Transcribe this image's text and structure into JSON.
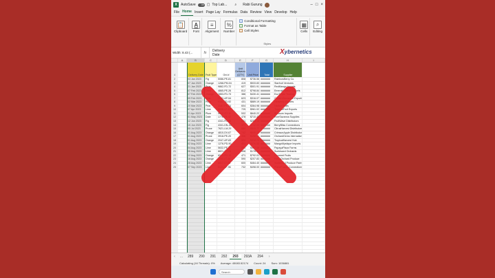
{
  "titlebar": {
    "autosave": "AutoSave",
    "toggle": "Off",
    "filename": "Top Lab...",
    "user": "Rabi Gurung"
  },
  "ribbon_tabs": [
    "File",
    "Home",
    "Insert",
    "Page Lay",
    "Formulas",
    "Data",
    "Review",
    "View",
    "Develop",
    "Help"
  ],
  "ribbon": {
    "clipboard": "Clipboard",
    "font": "Font",
    "alignment": "Alignment",
    "number": "Number",
    "cond_format": "Conditional Formatting",
    "format_table": "Format as Table",
    "cell_styles": "Cell Styles",
    "styles": "Styles",
    "cells": "Cells",
    "editing": "Editing"
  },
  "watermark": {
    "x": "X",
    "text": "ybernetics"
  },
  "formula_bar": {
    "namebox": "Width: 8.43 (...",
    "fx": "fx",
    "value_line1": "Delivery",
    "value_line2": "Date"
  },
  "columns": [
    "A",
    "B",
    "C",
    "D",
    "E",
    "F",
    "G",
    "H",
    "I"
  ],
  "header_row": {
    "num": "4",
    "b": "Delivery Date",
    "c": "Fruit Type",
    "d": "Ord #",
    "e": "Unit Delivered (QTY)",
    "f": "Unit Price",
    "g": "Total",
    "h": "Supplier"
  },
  "rows": [
    {
      "n": "2",
      "b": "03 Jan 2023",
      "c": "Fig",
      "d": "5086-PE-81",
      "e": "808",
      "f": "$736.56",
      "g": "#######",
      "h": "RainbowBerry Co."
    },
    {
      "n": "3",
      "b": "07 Jan 2023",
      "c": "Orange",
      "d": "1268-PM-04",
      "e": "419",
      "f": "$533.83",
      "g": "#######",
      "h": "Starfruit Ventures"
    },
    {
      "n": "4",
      "b": "21 Jan 2023",
      "c": "Pear",
      "d": "9862-FD-72",
      "e": "627",
      "f": "$501.91",
      "g": "#######",
      "h": "RedMango Imports"
    },
    {
      "n": "5",
      "b": "07 Feb 2023",
      "c": "Lime",
      "d": "4865-PE-26",
      "e": "812",
      "f": "$798.84",
      "g": "#######",
      "h": "EmeraldHarbor Exports"
    },
    {
      "n": "6",
      "b": "07 Feb 2023",
      "c": "Orange",
      "d": "2853-FD-73",
      "e": "386",
      "f": "$430.41",
      "g": "#######",
      "h": "ExoTropic Trading"
    },
    {
      "n": "7",
      "b": "09 Feb 2023",
      "c": "Pear",
      "d": "7402-AP-54",
      "e": "623",
      "f": "$316.07",
      "g": "#######",
      "h": "GoldenGemstone Exports"
    },
    {
      "n": "8",
      "b": "02 Mar 2023",
      "c": "Plum",
      "d": "9152-FD-92",
      "e": "431",
      "f": "$889.19",
      "g": "#######",
      "h": "Heavenly Exports"
    },
    {
      "n": "9",
      "b": "20 Mar 2023",
      "c": "Pear",
      "d": "3187-PE-34",
      "e": "604",
      "f": "$364.98",
      "g": "#######",
      "h": "Harbor Fruits"
    },
    {
      "n": "10",
      "b": "07 Apr 2023",
      "c": "Lime",
      "d": "6638-LF-43",
      "e": "725",
      "f": "$961.02",
      "g": "#######",
      "h": "TropicalFruit Exports"
    },
    {
      "n": "11",
      "b": "21 Apr 2023",
      "c": "Plum",
      "d": "5012-GT-11",
      "e": "532",
      "f": "$640.22",
      "g": "#######",
      "h": "Blossom Imports"
    },
    {
      "n": "12",
      "b": "01 May 2023",
      "c": "Date",
      "d": "1778-PE-52",
      "e": "478",
      "f": "$710.45",
      "g": "#######",
      "h": "EverSavanna Supplies"
    },
    {
      "n": "13",
      "b": "12 Jun 2023",
      "c": "Fig",
      "d": "4341-FD-88",
      "e": "501",
      "f": "$288.15",
      "g": "#######",
      "h": "FruitWave Distributors"
    },
    {
      "n": "14",
      "b": "15 Jun 2023",
      "c": "Fig",
      "d": "4341-DN-45",
      "e": "377",
      "f": "$712.33",
      "g": "#######",
      "h": "BerryBliss Connections"
    },
    {
      "n": "15",
      "b": "05 Jul 2023",
      "c": "Prune",
      "d": "7621-LM-29",
      "e": "660",
      "f": "$540.77",
      "g": "#######",
      "h": "CitrusHarvest Distributors"
    },
    {
      "n": "16",
      "b": "01 Aug 2023",
      "c": "Orange",
      "d": "4810-DV-67",
      "e": "742",
      "f": "$605.12",
      "g": "#######",
      "h": "CrimsonApple Distributors"
    },
    {
      "n": "17",
      "b": "01 Aug 2023",
      "c": "Prune",
      "d": "3918-PE-20",
      "e": "366",
      "f": "$498.41",
      "g": "#######",
      "h": "OrchardGems International"
    },
    {
      "n": "18",
      "b": "01 Aug 2023",
      "c": "Orange",
      "d": "2047-AP-83",
      "e": "594",
      "f": "$318.29",
      "g": "#######",
      "h": "TropicalHarvest Hub"
    },
    {
      "n": "19",
      "b": "02 Aug 2023",
      "c": "Lime",
      "d": "1276-PD-90",
      "e": "401",
      "f": "$476.55",
      "g": "#######",
      "h": "MangoMystique Imports"
    },
    {
      "n": "20",
      "b": "04 Aug 2023",
      "c": "Lime",
      "d": "5632-PE-77",
      "e": "551",
      "f": "$467.68",
      "g": "#######",
      "h": "PapayaPlaza Farms"
    },
    {
      "n": "21",
      "b": "06 Aug 2023",
      "c": "Lime",
      "d": "8821-GT-04",
      "e": "598",
      "f": "$176.61",
      "g": "#######",
      "h": "Sunkissed Orchards"
    },
    {
      "n": "22",
      "b": "12 Aug 2023",
      "c": "Orange",
      "d": "6540-FD-12",
      "e": "471",
      "f": "$792.01",
      "g": "#######",
      "h": "Gourmet Fruits"
    },
    {
      "n": "23",
      "b": "16 Aug 2023",
      "c": "Orange",
      "d": "7290-LT-08",
      "e": "590",
      "f": "$207.83",
      "g": "#######",
      "h": "FreshOrchard Produce"
    },
    {
      "n": "24",
      "b": "28 Aug 2023",
      "c": "Lime",
      "d": "8817-LT-03",
      "e": "600",
      "f": "$464.40",
      "g": "#######",
      "h": "Sunkissed Produce Partners"
    },
    {
      "n": "25",
      "b": "07 Sep 2023",
      "c": "Lime",
      "d": "5141-LF-96",
      "e": "732",
      "f": "$498.00",
      "g": "#######",
      "h": "PrimeFusion Connections"
    }
  ],
  "sheet_tabs": [
    "289",
    "290",
    "291",
    "292",
    "293",
    "293A",
    "294"
  ],
  "active_sheet": "293",
  "statusbar": {
    "status": "Calculating (16 Threads): 0%",
    "average": "Average: 45083.52174",
    "count": "Count: 24",
    "sum": "Sum: 1036881"
  },
  "taskbar": {
    "search": "Search"
  }
}
